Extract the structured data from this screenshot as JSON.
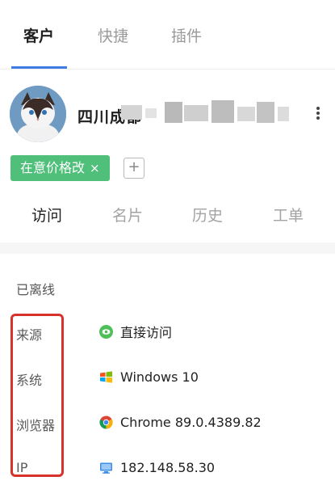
{
  "top_tabs": [
    {
      "label": "客户",
      "active": true
    },
    {
      "label": "快捷",
      "active": false
    },
    {
      "label": "插件",
      "active": false
    }
  ],
  "profile": {
    "name_visible": "四川成都",
    "tag": {
      "label": "在意价格改",
      "close": "×"
    },
    "add_tag": "+"
  },
  "sub_tabs": [
    {
      "label": "访问",
      "active": true
    },
    {
      "label": "名片",
      "active": false
    },
    {
      "label": "历史",
      "active": false
    },
    {
      "label": "工单",
      "active": false
    }
  ],
  "status": "已离线",
  "info": {
    "source": {
      "label": "来源",
      "value": "直接访问",
      "icon": "eye-icon"
    },
    "system": {
      "label": "系统",
      "value": "Windows 10",
      "icon": "windows-icon"
    },
    "browser": {
      "label": "浏览器",
      "value": "Chrome 89.0.4389.82",
      "icon": "chrome-icon"
    },
    "ip": {
      "label": "IP",
      "value": "182.148.58.30",
      "icon": "monitor-icon"
    }
  },
  "colors": {
    "accent": "#3f7be6",
    "tag": "#4fbf7a",
    "highlight": "#d7322b"
  }
}
